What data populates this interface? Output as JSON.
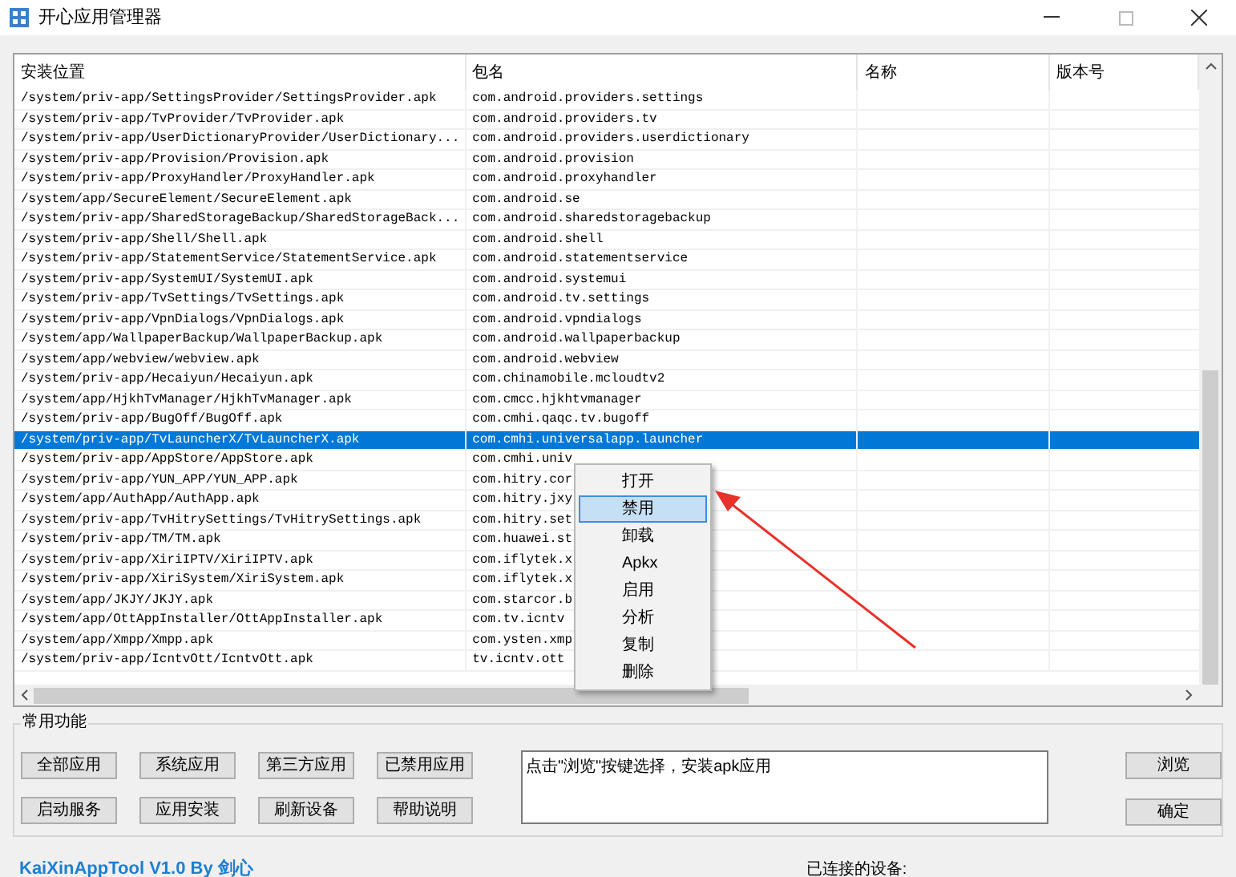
{
  "window": {
    "title": "开心应用管理器"
  },
  "table": {
    "columns": [
      "安装位置",
      "包名",
      "名称",
      "版本号"
    ],
    "rows": [
      {
        "path": "/system/priv-app/SettingsProvider/SettingsProvider.apk",
        "package": "com.android.providers.settings",
        "selected": false
      },
      {
        "path": "/system/priv-app/TvProvider/TvProvider.apk",
        "package": "com.android.providers.tv",
        "selected": false
      },
      {
        "path": "/system/priv-app/UserDictionaryProvider/UserDictionary...",
        "package": "com.android.providers.userdictionary",
        "selected": false
      },
      {
        "path": "/system/priv-app/Provision/Provision.apk",
        "package": "com.android.provision",
        "selected": false
      },
      {
        "path": "/system/priv-app/ProxyHandler/ProxyHandler.apk",
        "package": "com.android.proxyhandler",
        "selected": false
      },
      {
        "path": "/system/app/SecureElement/SecureElement.apk",
        "package": "com.android.se",
        "selected": false
      },
      {
        "path": "/system/priv-app/SharedStorageBackup/SharedStorageBack...",
        "package": "com.android.sharedstoragebackup",
        "selected": false
      },
      {
        "path": "/system/priv-app/Shell/Shell.apk",
        "package": "com.android.shell",
        "selected": false
      },
      {
        "path": "/system/priv-app/StatementService/StatementService.apk",
        "package": "com.android.statementservice",
        "selected": false
      },
      {
        "path": "/system/priv-app/SystemUI/SystemUI.apk",
        "package": "com.android.systemui",
        "selected": false
      },
      {
        "path": "/system/priv-app/TvSettings/TvSettings.apk",
        "package": "com.android.tv.settings",
        "selected": false
      },
      {
        "path": "/system/priv-app/VpnDialogs/VpnDialogs.apk",
        "package": "com.android.vpndialogs",
        "selected": false
      },
      {
        "path": "/system/app/WallpaperBackup/WallpaperBackup.apk",
        "package": "com.android.wallpaperbackup",
        "selected": false
      },
      {
        "path": "/system/app/webview/webview.apk",
        "package": "com.android.webview",
        "selected": false
      },
      {
        "path": "/system/priv-app/Hecaiyun/Hecaiyun.apk",
        "package": "com.chinamobile.mcloudtv2",
        "selected": false
      },
      {
        "path": "/system/app/HjkhTvManager/HjkhTvManager.apk",
        "package": "com.cmcc.hjkhtvmanager",
        "selected": false
      },
      {
        "path": "/system/priv-app/BugOff/BugOff.apk",
        "package": "com.cmhi.qaqc.tv.bugoff",
        "selected": false
      },
      {
        "path": "/system/priv-app/TvLauncherX/TvLauncherX.apk",
        "package": "com.cmhi.universalapp.launcher",
        "selected": true
      },
      {
        "path": "/system/priv-app/AppStore/AppStore.apk",
        "package": "com.cmhi.univ",
        "selected": false
      },
      {
        "path": "/system/priv-app/YUN_APP/YUN_APP.apk",
        "package": "com.hitry.cor",
        "selected": false
      },
      {
        "path": "/system/app/AuthApp/AuthApp.apk",
        "package": "com.hitry.jxy",
        "selected": false
      },
      {
        "path": "/system/priv-app/TvHitrySettings/TvHitrySettings.apk",
        "package": "com.hitry.set",
        "selected": false
      },
      {
        "path": "/system/priv-app/TM/TM.apk",
        "package": "com.huawei.st",
        "selected": false
      },
      {
        "path": "/system/priv-app/XiriIPTV/XiriIPTV.apk",
        "package": "com.iflytek.x",
        "selected": false
      },
      {
        "path": "/system/priv-app/XiriSystem/XiriSystem.apk",
        "package": "com.iflytek.x",
        "selected": false
      },
      {
        "path": "/system/app/JKJY/JKJY.apk",
        "package": "com.starcor.b",
        "selected": false
      },
      {
        "path": "/system/app/OttAppInstaller/OttAppInstaller.apk",
        "package": "com.tv.icntv",
        "selected": false
      },
      {
        "path": "/system/app/Xmpp/Xmpp.apk",
        "package": "com.ysten.xmp",
        "selected": false
      },
      {
        "path": "/system/priv-app/IcntvOtt/IcntvOtt.apk",
        "package": "tv.icntv.ott",
        "selected": false
      }
    ]
  },
  "context_menu": [
    {
      "label": "打开",
      "selected": false
    },
    {
      "label": "禁用",
      "selected": true
    },
    {
      "label": "卸载",
      "selected": false
    },
    {
      "label": "Apkx",
      "selected": false
    },
    {
      "label": "启用",
      "selected": false
    },
    {
      "label": "分析",
      "selected": false
    },
    {
      "label": "复制",
      "selected": false
    },
    {
      "label": "删除",
      "selected": false
    }
  ],
  "group": {
    "title": "常用功能",
    "buttons": [
      [
        "全部应用",
        "系统应用",
        "第三方应用",
        "已禁用应用"
      ],
      [
        "启动服务",
        "应用安装",
        "刷新设备",
        "帮助说明"
      ]
    ],
    "message": "点击\"浏览\"按键选择，安装apk应用",
    "side_buttons": [
      "浏览",
      "确定"
    ]
  },
  "footer": {
    "credit": "KaiXinAppTool V1.0 By 剑心",
    "device_label": "已连接的设备:"
  }
}
